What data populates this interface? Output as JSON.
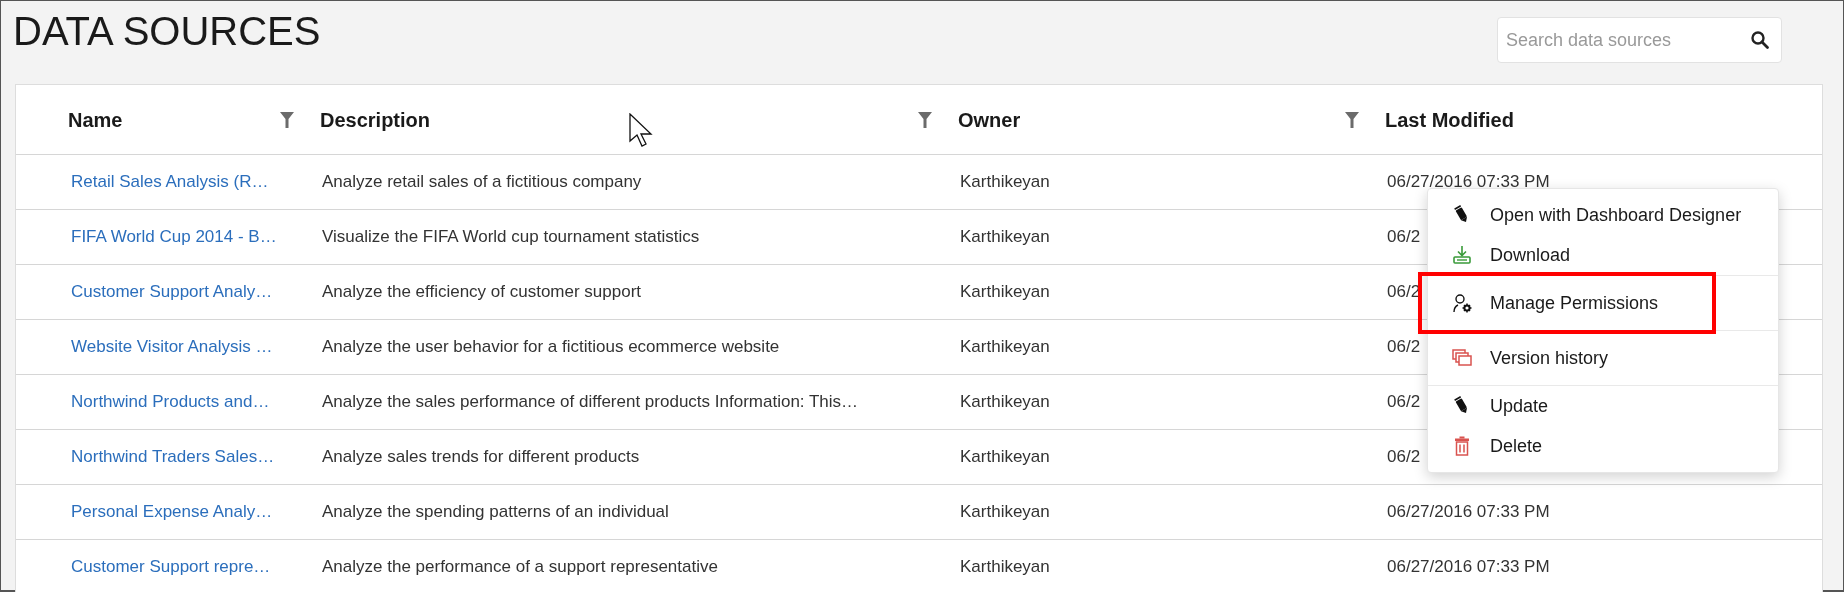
{
  "page": {
    "title": "DATA SOURCES"
  },
  "search": {
    "placeholder": "Search data sources"
  },
  "table": {
    "columns": [
      {
        "label": "Name",
        "filterable": true
      },
      {
        "label": "Description",
        "filterable": true
      },
      {
        "label": "Owner",
        "filterable": true
      },
      {
        "label": "Last Modified",
        "filterable": false
      }
    ],
    "rows": [
      {
        "name": "Retail Sales Analysis (R…",
        "description": "Analyze retail sales of a fictitious company",
        "owner": "Karthikeyan",
        "last_modified": "06/27/2016 07:33 PM"
      },
      {
        "name": "FIFA World Cup 2014 - B…",
        "description": "Visualize the FIFA World cup tournament statistics",
        "owner": "Karthikeyan",
        "last_modified": "06/2"
      },
      {
        "name": "Customer Support Analy…",
        "description": "Analyze the efficiency of customer support",
        "owner": "Karthikeyan",
        "last_modified": "06/2"
      },
      {
        "name": "Website Visitor Analysis …",
        "description": "Analyze the user behavior for a fictitious ecommerce website",
        "owner": "Karthikeyan",
        "last_modified": "06/2"
      },
      {
        "name": "Northwind Products and…",
        "description": "Analyze the sales performance of different products Information: This…",
        "owner": "Karthikeyan",
        "last_modified": "06/2"
      },
      {
        "name": "Northwind Traders Sales…",
        "description": "Analyze sales trends for different products",
        "owner": "Karthikeyan",
        "last_modified": "06/2"
      },
      {
        "name": "Personal Expense Analy…",
        "description": "Analyze the spending patterns of an individual",
        "owner": "Karthikeyan",
        "last_modified": "06/27/2016 07:33 PM"
      },
      {
        "name": "Customer Support repre…",
        "description": "Analyze the performance of a support representative",
        "owner": "Karthikeyan",
        "last_modified": "06/27/2016 07:33 PM"
      }
    ]
  },
  "context_menu": {
    "groups": [
      [
        {
          "kind": "edit",
          "label": "Open with Dashboard Designer",
          "highlighted": false
        },
        {
          "kind": "download",
          "label": "Download",
          "highlighted": false
        }
      ],
      [
        {
          "kind": "permissions",
          "label": "Manage Permissions",
          "highlighted": true
        }
      ],
      [
        {
          "kind": "history",
          "label": "Version history",
          "highlighted": false
        }
      ],
      [
        {
          "kind": "edit",
          "label": "Update",
          "highlighted": false
        },
        {
          "kind": "delete",
          "label": "Delete",
          "highlighted": false
        }
      ]
    ]
  }
}
